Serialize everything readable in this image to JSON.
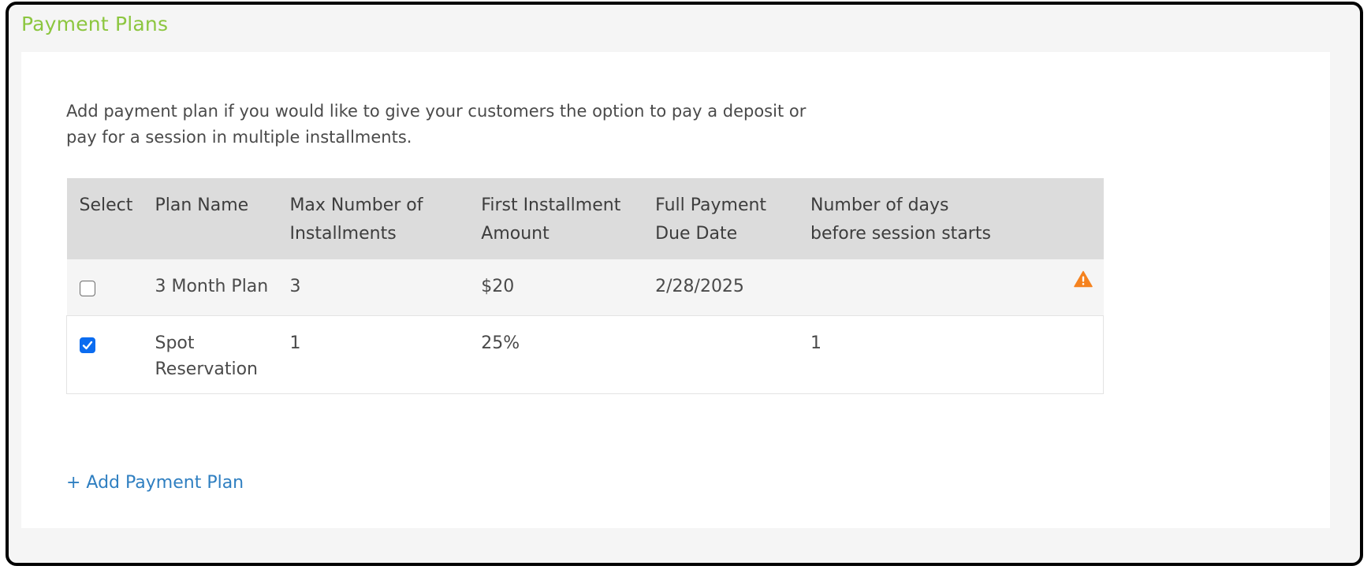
{
  "section": {
    "title": "Payment Plans"
  },
  "intro_line1": "Add payment plan if you would like to give your customers the option to pay a deposit or",
  "intro_line2": "pay for a session in multiple installments.",
  "table": {
    "headers": {
      "select": "Select",
      "plan_name": "Plan Name",
      "max_installments_1": "Max Number of",
      "max_installments_2": "Installments",
      "first_amount_1": "First Installment",
      "first_amount_2": "Amount",
      "full_due_1": "Full Payment",
      "full_due_2": "Due Date",
      "days_before_1": "Number of days",
      "days_before_2": "before session starts"
    },
    "rows": [
      {
        "selected": false,
        "plan_name": "3 Month Plan",
        "max_installments": "3",
        "first_amount": "$20",
        "full_due_date": "2/28/2025",
        "days_before": "",
        "warning": true
      },
      {
        "selected": true,
        "plan_name_1": "Spot",
        "plan_name_2": "Reservation",
        "max_installments": "1",
        "first_amount": "25%",
        "full_due_date": "",
        "days_before": "1",
        "warning": false
      }
    ]
  },
  "add_link": "+ Add Payment Plan",
  "colors": {
    "title_green": "#8cc63f",
    "link_blue": "#2f7fc1",
    "checkbox_blue": "#0b6cf0",
    "warning_orange": "#f5821f"
  },
  "icons": {
    "warning": "warning-triangle-icon",
    "check": "checkmark-icon"
  }
}
